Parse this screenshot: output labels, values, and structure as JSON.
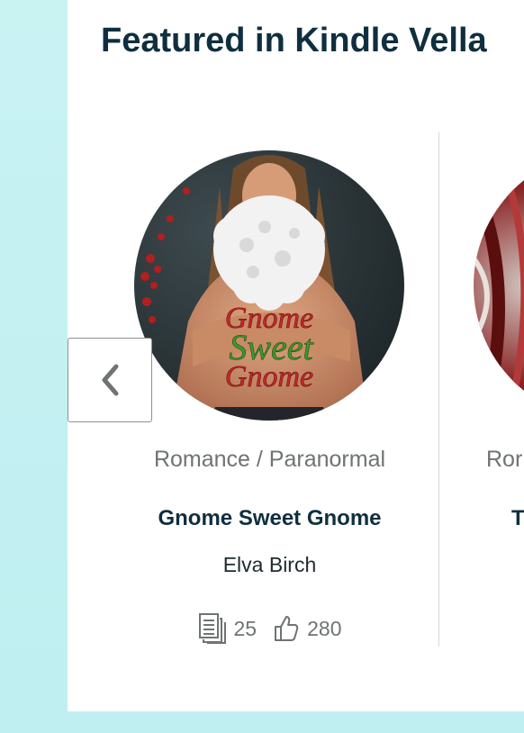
{
  "section": {
    "title": "Featured in Kindle Vella"
  },
  "carousel": {
    "prev_icon": "chevron-left-icon",
    "cards": [
      {
        "genre": "Romance / Paranormal",
        "title": "Gnome Sweet Gnome",
        "author": "Elva Birch",
        "episodes": "25",
        "likes": "280",
        "cover_text": [
          "Gnome",
          "Sweet",
          "Gnome"
        ]
      },
      {
        "genre": "Ror",
        "title": "T"
      }
    ]
  },
  "colors": {
    "background": "#c9f2f3",
    "title": "#0f2f3f",
    "muted": "#6f7373",
    "cover_red": "#c22a2a",
    "cover_green": "#3c9a2a"
  }
}
